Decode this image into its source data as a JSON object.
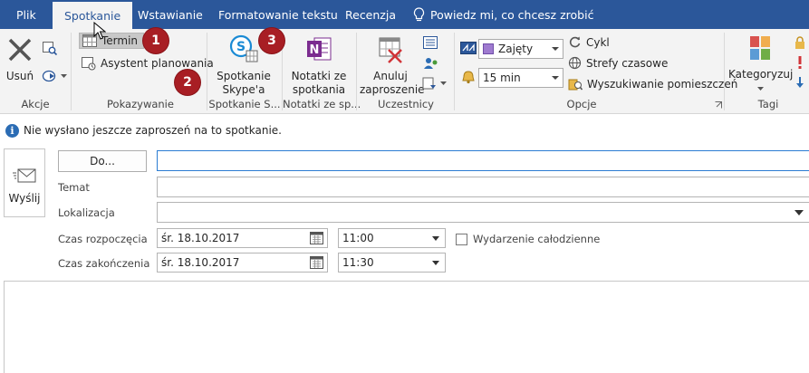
{
  "tabs": [
    {
      "label": "Plik",
      "active": false
    },
    {
      "label": "Spotkanie",
      "active": true
    },
    {
      "label": "Wstawianie",
      "active": false
    },
    {
      "label": "Formatowanie tekstu",
      "active": false
    },
    {
      "label": "Recenzja",
      "active": false
    }
  ],
  "tell_me": "Powiedz mi, co chcesz zrobić",
  "ribbon": {
    "akcje": {
      "label": "Akcje",
      "delete": "Usuń"
    },
    "pokazywanie": {
      "label": "Pokazywanie",
      "termin": "Termin",
      "assistant": "Asystent planowania"
    },
    "skype": {
      "label": "Spotkanie S...",
      "button_line1": "Spotkanie",
      "button_line2": "Skype'a"
    },
    "notes": {
      "label": "Notatki ze sp...",
      "button_line1": "Notatki ze",
      "button_line2": "spotkania"
    },
    "attendees": {
      "label": "Uczestnicy",
      "cancel_line1": "Anuluj",
      "cancel_line2": "zaproszenie"
    },
    "options": {
      "label": "Opcje",
      "show_as": "Zajęty",
      "reminder": "15 min",
      "recurrence": "Cykl",
      "timezones": "Strefy czasowe",
      "room_finder": "Wyszukiwanie pomieszczeń"
    },
    "tags": {
      "label": "Tagi",
      "categorize": "Kategoryzuj"
    }
  },
  "badges": [
    "1",
    "2",
    "3"
  ],
  "info": "Nie wysłano jeszcze zaproszeń na to spotkanie.",
  "form": {
    "send": "Wyślij",
    "to_button": "Do...",
    "subject_label": "Temat",
    "location_label": "Lokalizacja",
    "start_label": "Czas rozpoczęcia",
    "end_label": "Czas zakończenia",
    "start_date": "śr. 18.10.2017",
    "start_time": "11:00",
    "end_date": "śr. 18.10.2017",
    "end_time": "11:30",
    "all_day": "Wydarzenie całodzienne"
  },
  "colors": {
    "accent": "#2b579a",
    "badge": "#a81e24",
    "onenote": "#7b2c8f"
  }
}
